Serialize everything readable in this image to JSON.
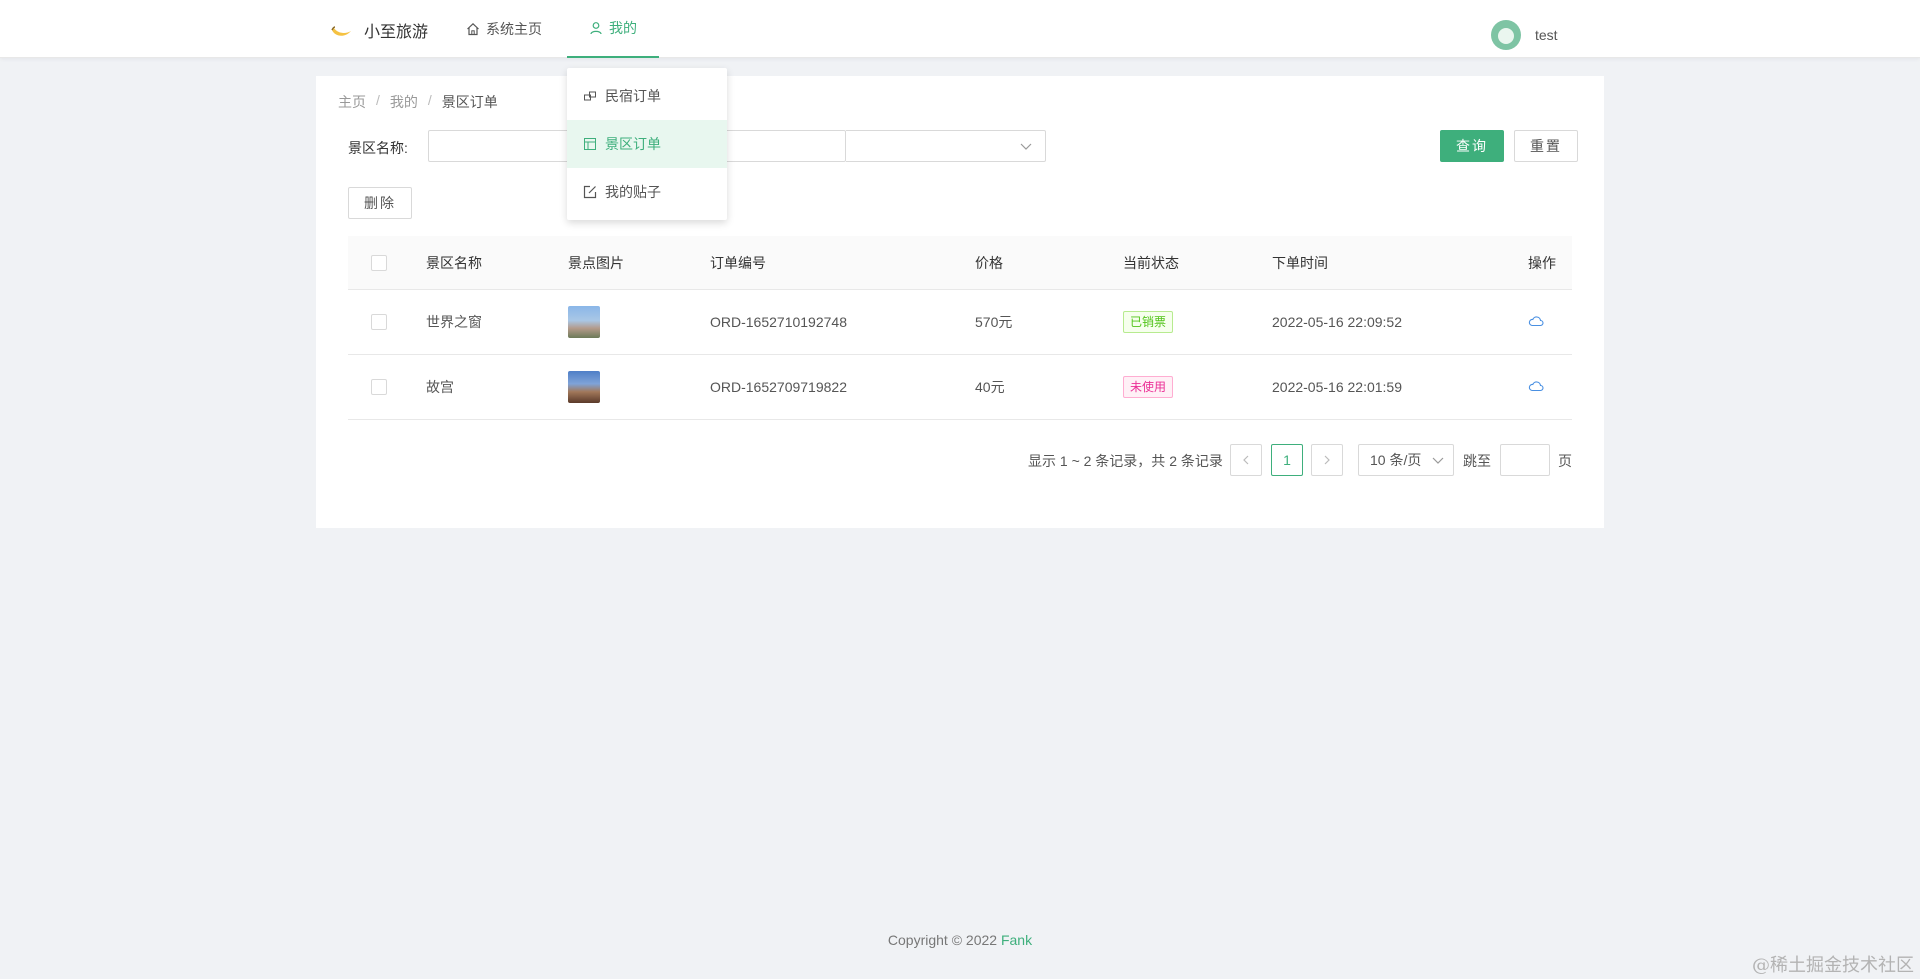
{
  "header": {
    "brand": "小至旅游",
    "nav": {
      "home": "系统主页",
      "mine": "我的"
    },
    "user": "test"
  },
  "dropdown": {
    "items": [
      {
        "label": "民宿订单",
        "icon": "homestay-icon"
      },
      {
        "label": "景区订单",
        "icon": "scenic-icon",
        "active": true
      },
      {
        "label": "我的贴子",
        "icon": "post-icon"
      }
    ]
  },
  "breadcrumb": {
    "home": "主页",
    "mine": "我的",
    "current": "景区订单",
    "sep": "/"
  },
  "filter": {
    "label": "景区名称:",
    "value": "",
    "placeholder": ""
  },
  "buttons": {
    "query": "查询",
    "reset": "重置",
    "delete": "删除"
  },
  "table": {
    "columns": [
      "景区名称",
      "景点图片",
      "订单编号",
      "价格",
      "当前状态",
      "下单时间",
      "操作"
    ],
    "rows": [
      {
        "name": "世界之窗",
        "order": "ORD-1652710192748",
        "price": "570元",
        "status": "已销票",
        "status_color": "green",
        "time": "2022-05-16 22:09:52"
      },
      {
        "name": "故宫",
        "order": "ORD-1652709719822",
        "price": "40元",
        "status": "未使用",
        "status_color": "pink",
        "time": "2022-05-16 22:01:59"
      }
    ]
  },
  "pagination": {
    "summary": "显示 1 ~ 2 条记录，共 2 条记录",
    "current_page": "1",
    "page_size": "10 条/页",
    "jump_label": "跳至",
    "page_unit": "页"
  },
  "footer": {
    "copyright": "Copyright © 2022",
    "brand": "Fank"
  },
  "watermark": "@稀土掘金技术社区",
  "colors": {
    "accent": "#3eaf7c",
    "background": "#f0f2f5"
  }
}
